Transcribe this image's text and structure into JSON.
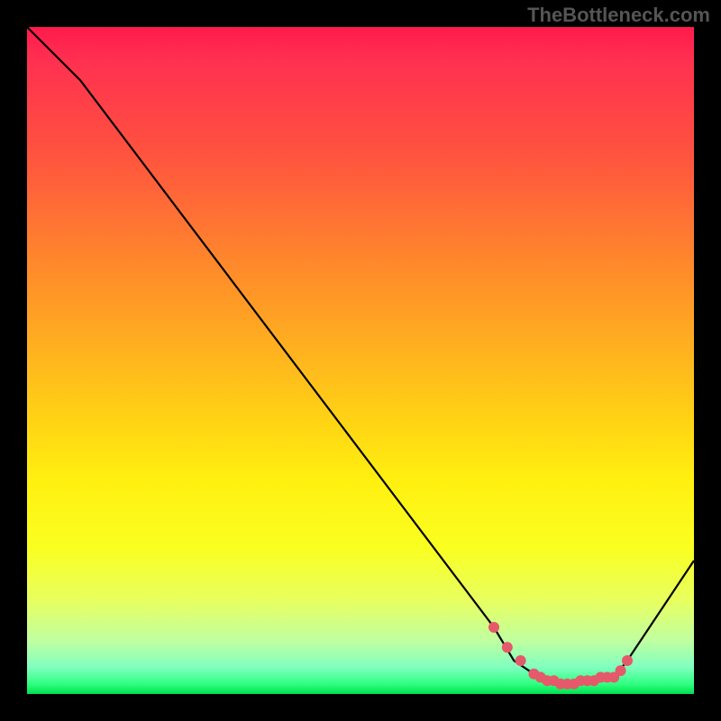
{
  "watermark": "TheBottleneck.com",
  "chart_data": {
    "type": "line",
    "title": "",
    "xlabel": "",
    "ylabel": "",
    "xlim": [
      0,
      100
    ],
    "ylim": [
      0,
      100
    ],
    "series": [
      {
        "name": "curve",
        "x": [
          0,
          8,
          70,
          73,
          76,
          78,
          80,
          82,
          84,
          86,
          88,
          90,
          100
        ],
        "y": [
          100,
          92,
          10,
          5,
          3,
          2,
          1.5,
          1.5,
          2,
          2.5,
          2.5,
          5,
          20
        ]
      }
    ],
    "markers": {
      "name": "highlight-dots",
      "x": [
        70,
        72,
        74,
        76,
        77,
        78,
        79,
        80,
        81,
        82,
        83,
        84,
        85,
        86,
        87,
        88,
        89,
        90
      ],
      "y": [
        10,
        7,
        5,
        3,
        2.5,
        2,
        2,
        1.5,
        1.5,
        1.5,
        2,
        2,
        2,
        2.5,
        2.5,
        2.5,
        3.5,
        5
      ]
    },
    "gradient_stops": [
      {
        "pos": 0,
        "color": "#ff1a4d"
      },
      {
        "pos": 0.5,
        "color": "#ffd015"
      },
      {
        "pos": 0.85,
        "color": "#e8ff60"
      },
      {
        "pos": 1.0,
        "color": "#00e050"
      }
    ]
  }
}
